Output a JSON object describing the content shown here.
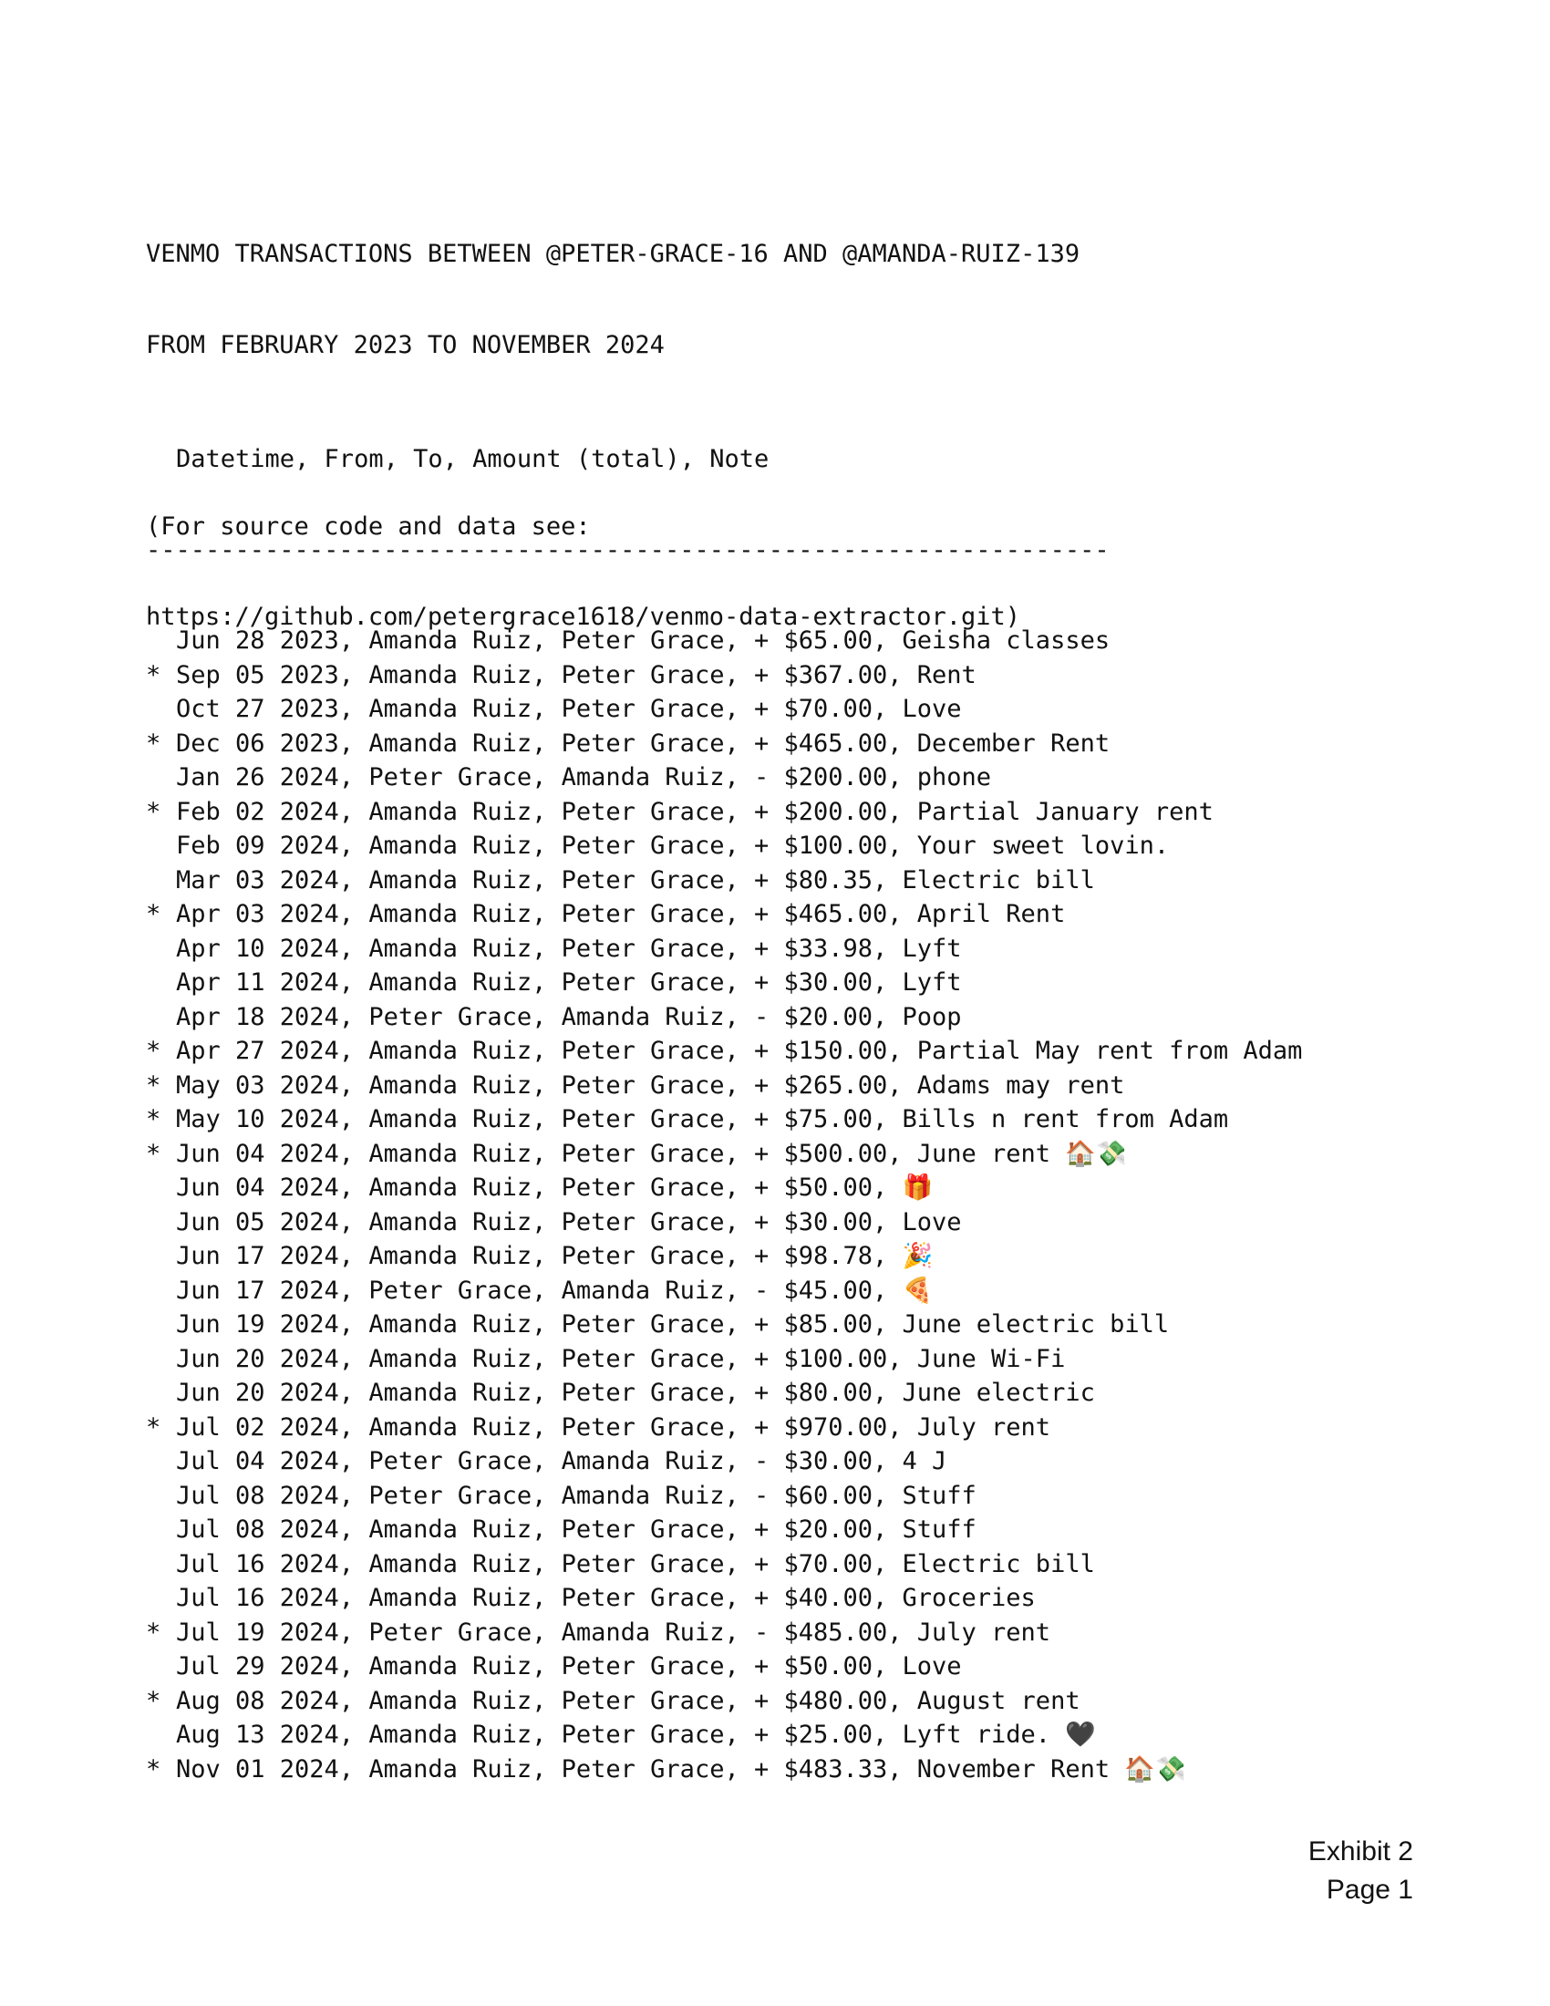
{
  "header": {
    "title_line1": "VENMO TRANSACTIONS BETWEEN @PETER-GRACE-16 AND @AMANDA-RUIZ-139",
    "title_line2": "FROM FEBRUARY 2023 TO NOVEMBER 2024",
    "source_line1": "(For source code and data see:",
    "source_line2": "https://github.com/petergrace1618/venmo-data-extractor.git)"
  },
  "table": {
    "columns_line": "Datetime, From, To, Amount (total), Note",
    "separator": "-----------------------------------------------------------------",
    "rows": [
      {
        "marker": " ",
        "text": "Jun 28 2023, Amanda Ruiz, Peter Grace, + $65.00, Geisha classes"
      },
      {
        "marker": "*",
        "text": "Sep 05 2023, Amanda Ruiz, Peter Grace, + $367.00, Rent"
      },
      {
        "marker": " ",
        "text": "Oct 27 2023, Amanda Ruiz, Peter Grace, + $70.00, Love"
      },
      {
        "marker": "*",
        "text": "Dec 06 2023, Amanda Ruiz, Peter Grace, + $465.00, December Rent"
      },
      {
        "marker": " ",
        "text": "Jan 26 2024, Peter Grace, Amanda Ruiz, - $200.00, phone"
      },
      {
        "marker": "*",
        "text": "Feb 02 2024, Amanda Ruiz, Peter Grace, + $200.00, Partial January rent"
      },
      {
        "marker": " ",
        "text": "Feb 09 2024, Amanda Ruiz, Peter Grace, + $100.00, Your sweet lovin."
      },
      {
        "marker": " ",
        "text": "Mar 03 2024, Amanda Ruiz, Peter Grace, + $80.35, Electric bill"
      },
      {
        "marker": "*",
        "text": "Apr 03 2024, Amanda Ruiz, Peter Grace, + $465.00, April Rent"
      },
      {
        "marker": " ",
        "text": "Apr 10 2024, Amanda Ruiz, Peter Grace, + $33.98, Lyft"
      },
      {
        "marker": " ",
        "text": "Apr 11 2024, Amanda Ruiz, Peter Grace, + $30.00, Lyft"
      },
      {
        "marker": " ",
        "text": "Apr 18 2024, Peter Grace, Amanda Ruiz, - $20.00, Poop"
      },
      {
        "marker": "*",
        "text": "Apr 27 2024, Amanda Ruiz, Peter Grace, + $150.00, Partial May rent from Adam"
      },
      {
        "marker": "*",
        "text": "May 03 2024, Amanda Ruiz, Peter Grace, + $265.00, Adams may rent"
      },
      {
        "marker": "*",
        "text": "May 10 2024, Amanda Ruiz, Peter Grace, + $75.00, Bills n rent from Adam"
      },
      {
        "marker": "*",
        "text": "Jun 04 2024, Amanda Ruiz, Peter Grace, + $500.00, June rent 🏠💸"
      },
      {
        "marker": " ",
        "text": "Jun 04 2024, Amanda Ruiz, Peter Grace, + $50.00, 🎁"
      },
      {
        "marker": " ",
        "text": "Jun 05 2024, Amanda Ruiz, Peter Grace, + $30.00, Love"
      },
      {
        "marker": " ",
        "text": "Jun 17 2024, Amanda Ruiz, Peter Grace, + $98.78, 🎉"
      },
      {
        "marker": " ",
        "text": "Jun 17 2024, Peter Grace, Amanda Ruiz, - $45.00, 🍕"
      },
      {
        "marker": " ",
        "text": "Jun 19 2024, Amanda Ruiz, Peter Grace, + $85.00, June electric bill"
      },
      {
        "marker": " ",
        "text": "Jun 20 2024, Amanda Ruiz, Peter Grace, + $100.00, June Wi-Fi"
      },
      {
        "marker": " ",
        "text": "Jun 20 2024, Amanda Ruiz, Peter Grace, + $80.00, June electric"
      },
      {
        "marker": "*",
        "text": "Jul 02 2024, Amanda Ruiz, Peter Grace, + $970.00, July rent"
      },
      {
        "marker": " ",
        "text": "Jul 04 2024, Peter Grace, Amanda Ruiz, - $30.00, 4 J"
      },
      {
        "marker": " ",
        "text": "Jul 08 2024, Peter Grace, Amanda Ruiz, - $60.00, Stuff"
      },
      {
        "marker": " ",
        "text": "Jul 08 2024, Amanda Ruiz, Peter Grace, + $20.00, Stuff"
      },
      {
        "marker": " ",
        "text": "Jul 16 2024, Amanda Ruiz, Peter Grace, + $70.00, Electric bill"
      },
      {
        "marker": " ",
        "text": "Jul 16 2024, Amanda Ruiz, Peter Grace, + $40.00, Groceries"
      },
      {
        "marker": "*",
        "text": "Jul 19 2024, Peter Grace, Amanda Ruiz, - $485.00, July rent"
      },
      {
        "marker": " ",
        "text": "Jul 29 2024, Amanda Ruiz, Peter Grace, + $50.00, Love"
      },
      {
        "marker": "*",
        "text": "Aug 08 2024, Amanda Ruiz, Peter Grace, + $480.00, August rent"
      },
      {
        "marker": " ",
        "text": "Aug 13 2024, Amanda Ruiz, Peter Grace, + $25.00, Lyft ride. 🖤"
      },
      {
        "marker": "*",
        "text": "Nov 01 2024, Amanda Ruiz, Peter Grace, + $483.33, November Rent 🏠💸"
      }
    ]
  },
  "footer": {
    "exhibit": "Exhibit 2",
    "page": "Page 1"
  }
}
